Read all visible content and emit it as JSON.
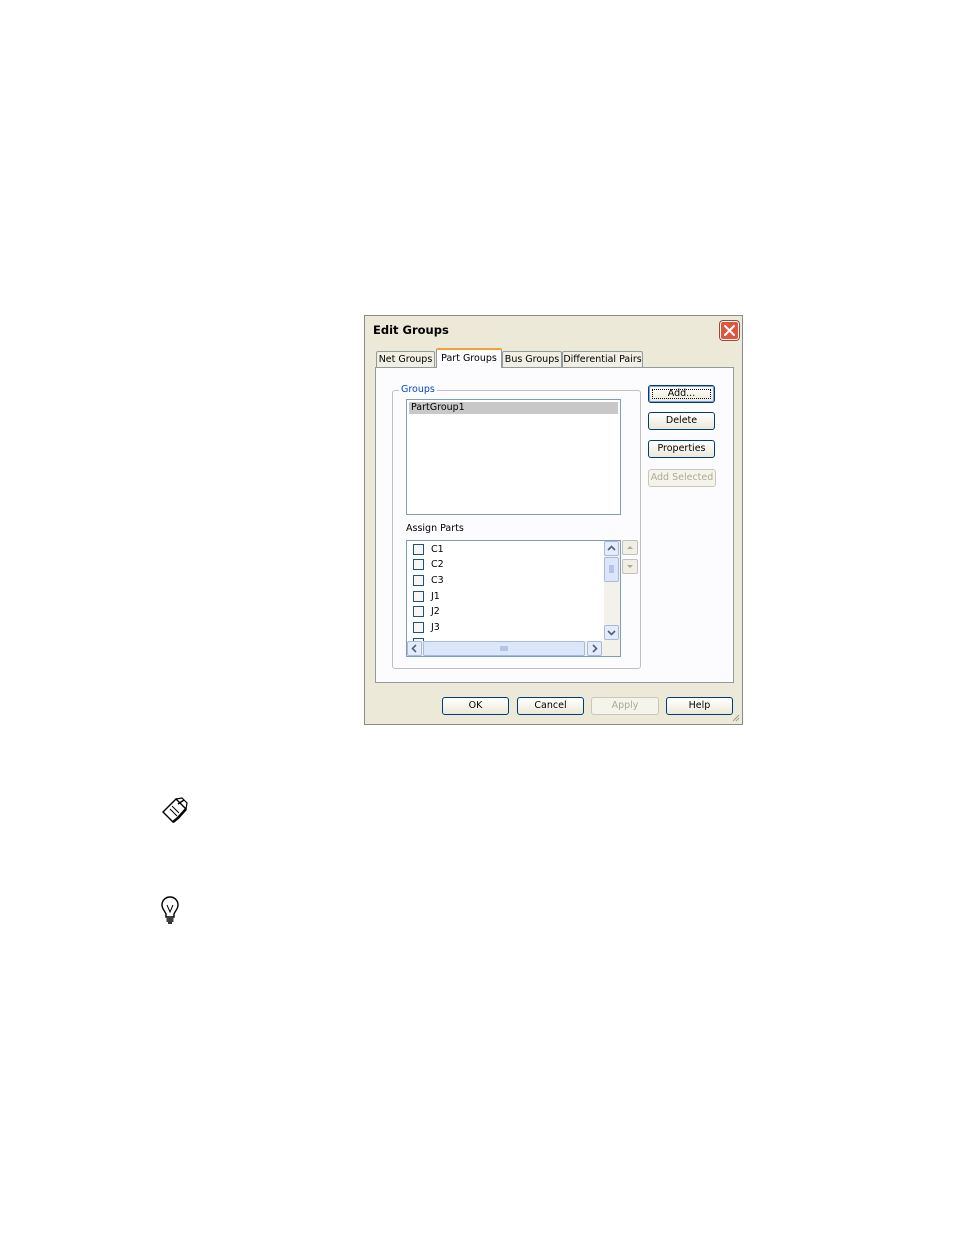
{
  "dialog": {
    "title": "Edit Groups",
    "tabs": [
      {
        "label": "Net Groups"
      },
      {
        "label": "Part Groups"
      },
      {
        "label": "Bus Groups"
      },
      {
        "label": "Differential Pairs"
      }
    ],
    "active_tab": "Part Groups",
    "groups": {
      "label": "Groups",
      "items": [
        "PartGroup1"
      ],
      "selected": "PartGroup1"
    },
    "assign_parts": {
      "label": "Assign Parts",
      "items": [
        {
          "label": "C1",
          "checked": false
        },
        {
          "label": "C2",
          "checked": false
        },
        {
          "label": "C3",
          "checked": false
        },
        {
          "label": "J1",
          "checked": false
        },
        {
          "label": "J2",
          "checked": false
        },
        {
          "label": "J3",
          "checked": false
        }
      ]
    },
    "side_buttons": {
      "add": "Add...",
      "delete": "Delete",
      "properties": "Properties",
      "add_selected": "Add Selected"
    },
    "footer_buttons": {
      "ok": "OK",
      "cancel": "Cancel",
      "apply": "Apply",
      "help": "Help"
    }
  },
  "icons": {
    "close": "close-icon",
    "note": "note-icon",
    "tip": "lightbulb-icon"
  },
  "colors": {
    "dialog_bg": "#ece9d8",
    "panel_bg": "#fcfcfe",
    "active_tab_accent": "#f0a23a",
    "groupbox_label": "#0046d5",
    "close_button": "#e0563c"
  }
}
